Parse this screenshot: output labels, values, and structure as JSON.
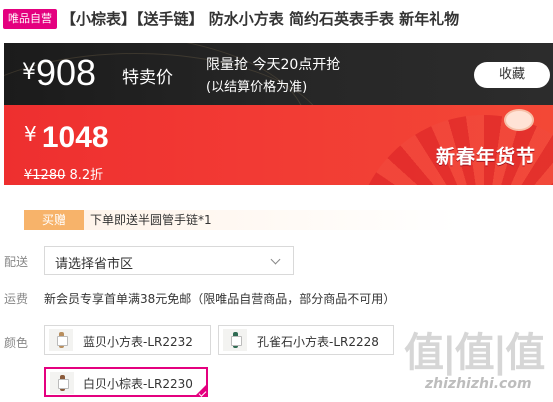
{
  "header": {
    "self_badge": "唯品自营",
    "title": "【小棕表】【送手链】 防水小方表 简约石英表手表 新年礼物"
  },
  "flash_sale": {
    "currency": "¥",
    "price": "908",
    "label": "特卖价",
    "info_line1": "限量抢 今天20点开抢",
    "info_line2": "(以结算价格为准)",
    "favorite_label": "收藏"
  },
  "price_banner": {
    "currency": "¥",
    "price": "1048",
    "original_price": "¥1280",
    "discount": "8.2折",
    "festival_text": "新春年货节"
  },
  "gift": {
    "badge": "买赠",
    "text": "下单即送半圆管手链*1"
  },
  "delivery": {
    "label": "配送",
    "placeholder": "请选择省市区"
  },
  "shipping": {
    "label": "运费",
    "text": "新会员专享首单满38元免邮（限唯品自营商品，部分商品不可用）"
  },
  "colors": {
    "label": "颜色",
    "options": [
      {
        "label": "蓝贝小方表-LR2232",
        "strap_color": "#b88e5e"
      },
      {
        "label": "孔雀石小方表-LR2228",
        "strap_color": "#2f6b53"
      },
      {
        "label": "白贝小棕表-LR2230",
        "strap_color": "#8a5a3a"
      }
    ],
    "selected_index": 2
  },
  "accent_colors": {
    "brand_pink": "#e4007f",
    "banner_red": "#f03b34",
    "dark_bar": "#222222"
  },
  "watermark": {
    "logo": "值|值|值",
    "url": "zhizhizhi.com"
  }
}
